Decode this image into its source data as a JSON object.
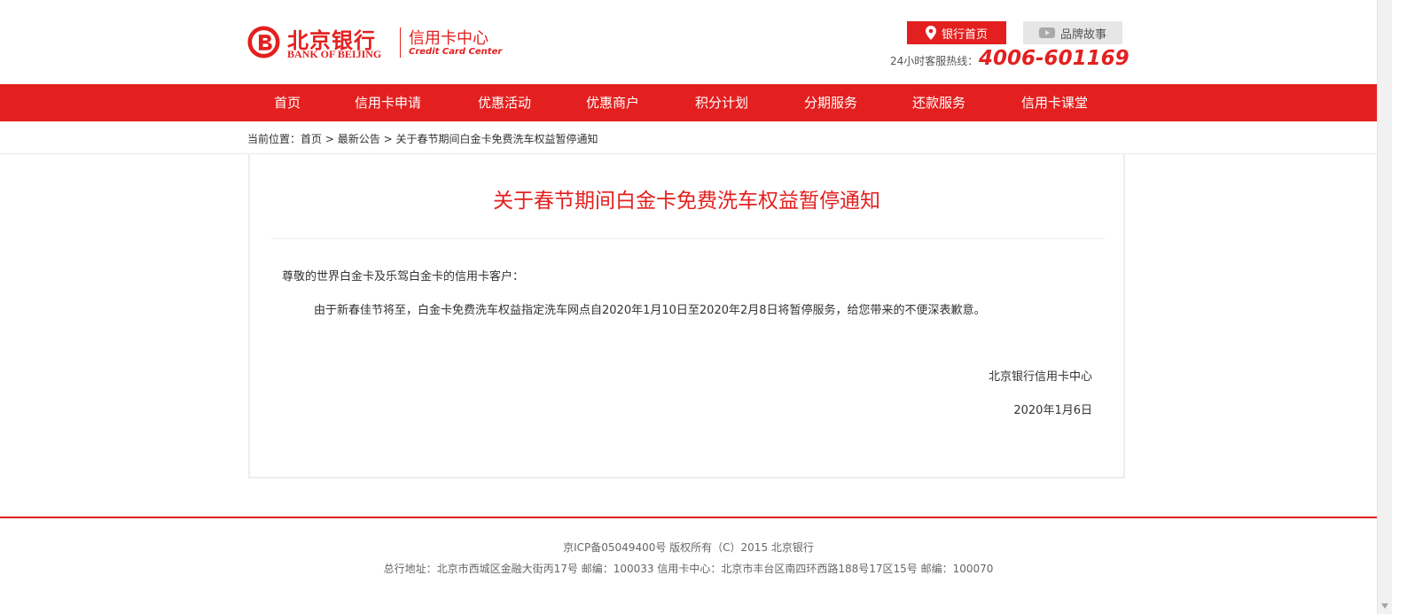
{
  "header": {
    "logo_cn": "北京银行",
    "logo_en": "BANK OF BEIJING",
    "logo_sub_cn": "信用卡中心",
    "logo_sub_en": "Credit Card Center",
    "home_button": "银行首页",
    "brand_button": "品牌故事",
    "hotline_label": "24小时客服热线：",
    "hotline_number": "4006-601169"
  },
  "nav": {
    "items": [
      {
        "label": "首页"
      },
      {
        "label": "信用卡申请"
      },
      {
        "label": "优惠活动"
      },
      {
        "label": "优惠商户"
      },
      {
        "label": "积分计划"
      },
      {
        "label": "分期服务"
      },
      {
        "label": "还款服务"
      },
      {
        "label": "信用卡课堂"
      }
    ]
  },
  "breadcrumb": {
    "prefix": "当前位置：",
    "items": [
      "首页",
      "最新公告",
      "关于春节期间白金卡免费洗车权益暂停通知"
    ],
    "separator": ">"
  },
  "article": {
    "title": "关于春节期间白金卡免费洗车权益暂停通知",
    "salutation": "尊敬的世界白金卡及乐驾白金卡的信用卡客户：",
    "body": "由于新春佳节将至，白金卡免费洗车权益指定洗车网点自2020年1月10日至2020年2月8日将暂停服务，给您带来的不便深表歉意。",
    "signature": "北京银行信用卡中心",
    "date": "2020年1月6日"
  },
  "footer": {
    "line1": "京ICP备05049400号  版权所有（C）2015  北京银行",
    "line2": "总行地址：北京市西城区金融大街丙17号  邮编：100033  信用卡中心：北京市丰台区南四环西路188号17区15号 邮编：100070"
  },
  "colors": {
    "brand_red": "#e3201f",
    "brand_button_gray": "#e6e6e6"
  },
  "icons": {
    "home": "location-pin-icon",
    "brand": "video-play-icon"
  }
}
